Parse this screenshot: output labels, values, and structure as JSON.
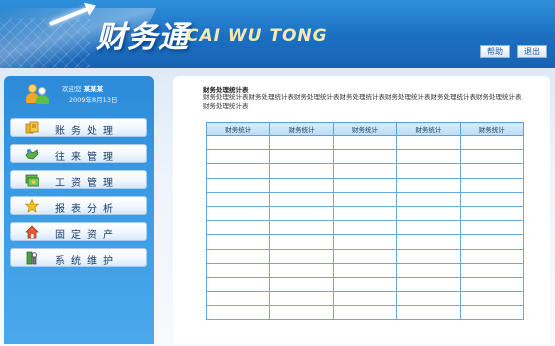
{
  "app": {
    "logo_cn": "财务通",
    "logo_en": "CAI WU TONG"
  },
  "header": {
    "help_label": "帮助",
    "exit_label": "退出"
  },
  "user": {
    "welcome_prefix": "欢迎您",
    "name": "某某某",
    "date": "2009年8月13日"
  },
  "sidebar": {
    "items": [
      {
        "label": "账务处理",
        "icon": "ledger-icon",
        "color": "#e9a319"
      },
      {
        "label": "往来管理",
        "icon": "handshake-icon",
        "color": "#4a9a3c"
      },
      {
        "label": "工资管理",
        "icon": "money-icon",
        "color": "#3f9a2e"
      },
      {
        "label": "报表分析",
        "icon": "star-icon",
        "color": "#f3b415"
      },
      {
        "label": "固定资产",
        "icon": "home-icon",
        "color": "#d44a2a"
      },
      {
        "label": "系统维护",
        "icon": "tools-icon",
        "color": "#3f8a3a"
      }
    ]
  },
  "main": {
    "title": "财务处理统计表",
    "description": "财务处理统计表财务处理统计表财务处理统计表财务处理统计表财务处理统计表财务处理统计表财务处理统计表财务处理统计表",
    "table": {
      "headers": [
        "财务统计",
        "财务统计",
        "财务统计",
        "财务统计",
        "财务统计"
      ],
      "row_count": 13
    }
  },
  "colors": {
    "header_blue": "#1b6fc2",
    "sidebar_blue": "#3a9ae3",
    "table_border": "#6aa9da"
  }
}
